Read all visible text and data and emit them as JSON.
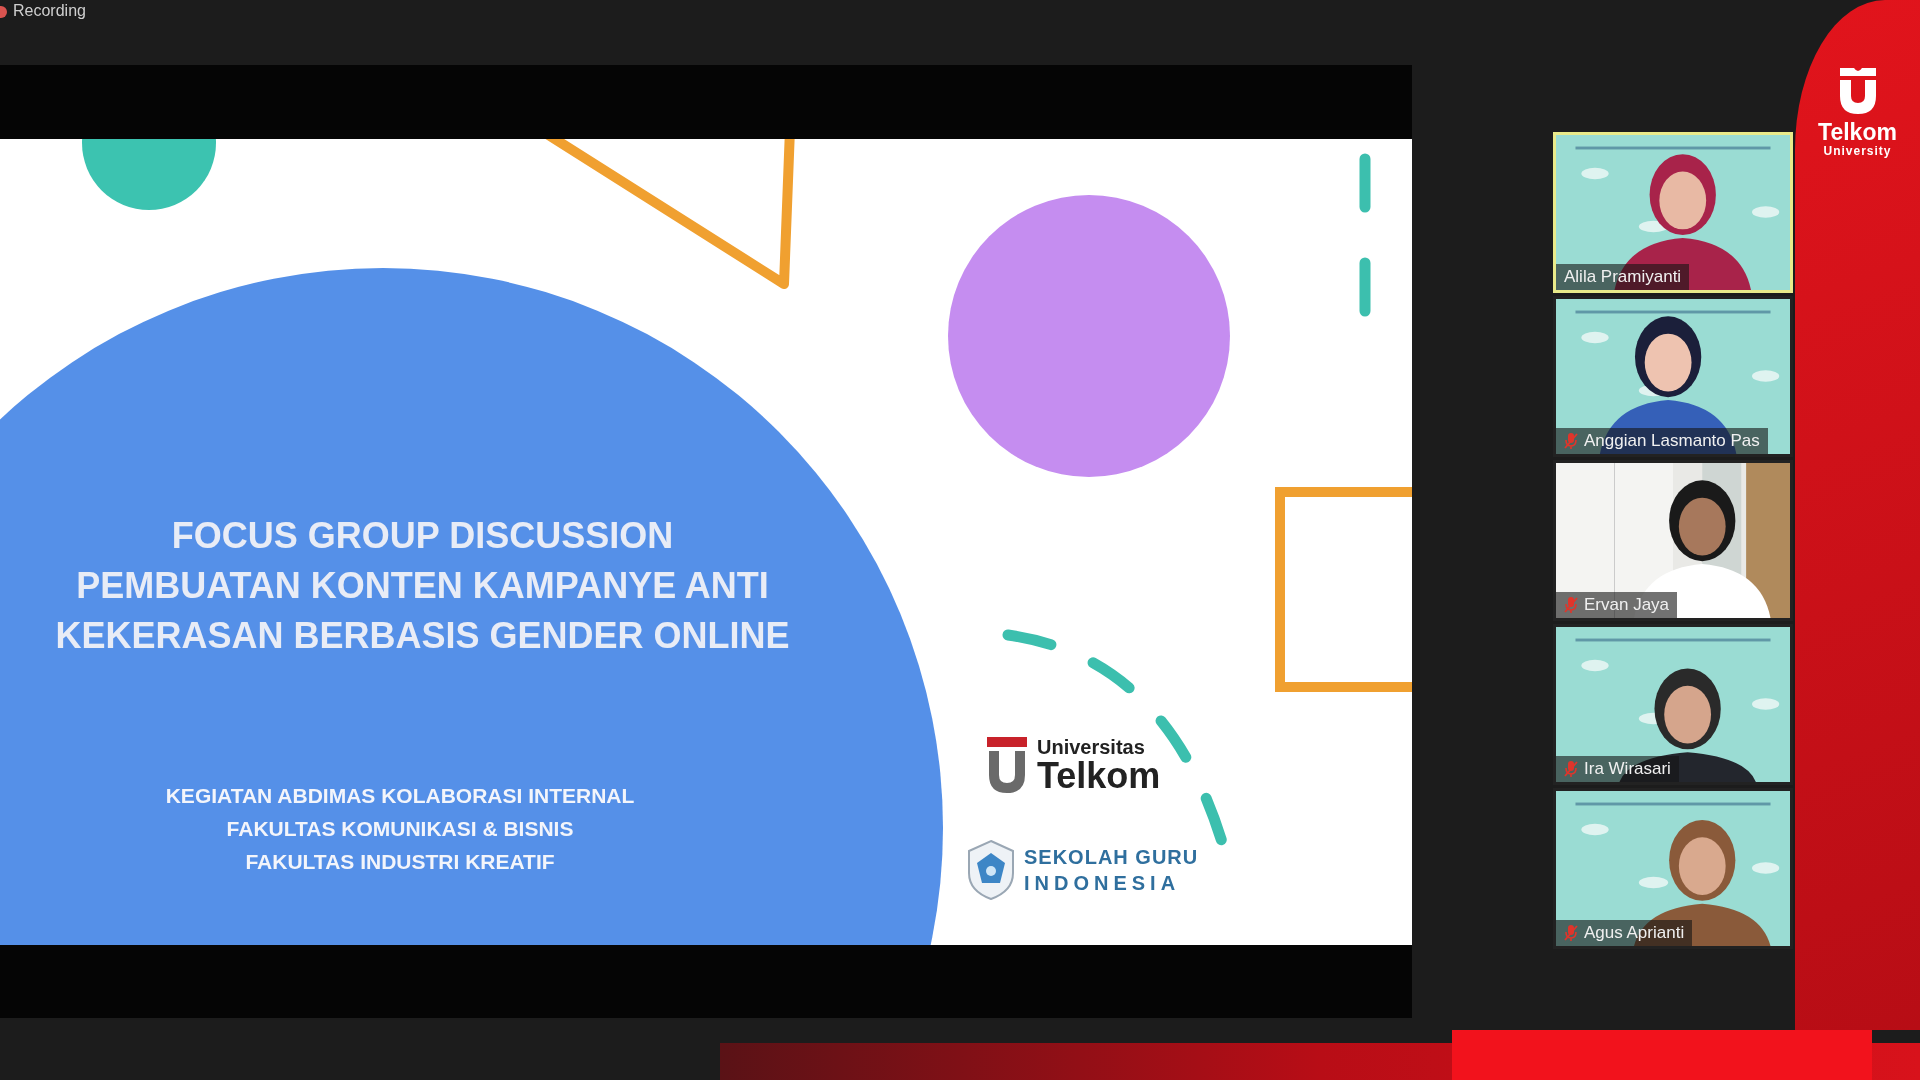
{
  "recording": {
    "label": "Recording"
  },
  "slide": {
    "title_lines": [
      "FOCUS GROUP DISCUSSION",
      "PEMBUATAN KONTEN KAMPANYE ANTI",
      "KEKERASAN BERBASIS GENDER ONLINE"
    ],
    "subtitle_lines": [
      "KEGIATAN ABDIMAS KOLABORASI INTERNAL",
      "FAKULTAS KOMUNIKASI & BISNIS",
      "FAKULTAS INDUSTRI KREATIF"
    ],
    "logos": [
      {
        "kind": "university",
        "top": "Universitas",
        "bottom": "Telkom"
      },
      {
        "kind": "school",
        "top": "SEKOLAH GURU",
        "bottom": "INDONESIA"
      }
    ]
  },
  "participants": [
    {
      "name": "Alila Pramiyanti",
      "speaking": true,
      "muted": false
    },
    {
      "name": "Anggian Lasmanto Pas",
      "speaking": false,
      "muted": true
    },
    {
      "name": "Ervan Jaya",
      "speaking": false,
      "muted": true
    },
    {
      "name": "Ira Wirasari",
      "speaking": false,
      "muted": true
    },
    {
      "name": "Agus Aprianti",
      "speaking": false,
      "muted": true
    }
  ],
  "brand": {
    "name": "Telkom",
    "subtitle": "University"
  }
}
